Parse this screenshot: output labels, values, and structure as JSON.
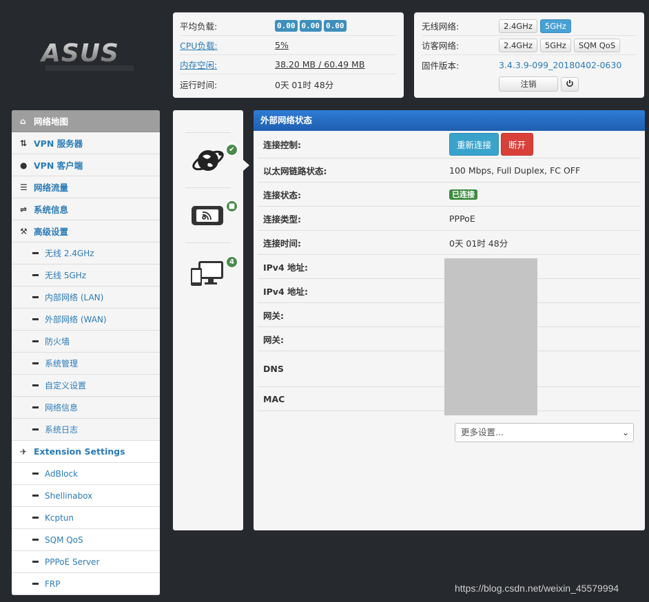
{
  "brand": {
    "logo_text": "ASUS"
  },
  "stats": {
    "avg_load_label": "平均负载:",
    "avg_load_values": [
      "0.00",
      "0.00",
      "0.00"
    ],
    "cpu_label": "CPU负载:",
    "cpu_value": "5%",
    "mem_label": "内存空闲:",
    "mem_value": "38.20 MB / 60.49 MB",
    "uptime_label": "运行时间:",
    "uptime_value": "0天 01时 48分"
  },
  "wifi": {
    "wireless_label": "无线网络:",
    "wireless_buttons": [
      "2.4GHz",
      "5GHz"
    ],
    "guest_label": "访客网络:",
    "guest_buttons": [
      "2.4GHz",
      "5GHz",
      "SQM QoS"
    ],
    "firmware_label": "固件版本:",
    "firmware_value": "3.4.3.9-099_20180402-0630",
    "logout_label": "注销",
    "power_icon": "power-icon"
  },
  "sidebar": {
    "items": [
      {
        "label": "网络地图",
        "icon": "home-icon"
      },
      {
        "label": "VPN 服务器",
        "icon": "retweet-icon"
      },
      {
        "label": "VPN 客户端",
        "icon": "globe-icon"
      },
      {
        "label": "网络流量",
        "icon": "list-icon"
      },
      {
        "label": "系统信息",
        "icon": "shuffle-icon"
      },
      {
        "label": "高级设置",
        "icon": "wrench-icon"
      }
    ],
    "advanced": [
      "无线 2.4GHz",
      "无线 5GHz",
      "内部网络 (LAN)",
      "外部网络 (WAN)",
      "防火墙",
      "系统管理",
      "自定义设置",
      "网络信息",
      "系统日志"
    ],
    "extension_label": "Extension Settings",
    "extension_icon": "plane-icon",
    "extensions": [
      "AdBlock",
      "Shellinabox",
      "Kcptun",
      "SQM QoS",
      "PPPoE Server",
      "FRP"
    ]
  },
  "devices": {
    "client_count": "4"
  },
  "wan": {
    "title": "外部网络状态",
    "rows": [
      {
        "label": "连接控制:",
        "value": ""
      },
      {
        "label": "以太网链路状态:",
        "value": "100 Mbps, Full Duplex, FC OFF"
      },
      {
        "label": "连接状态:",
        "value": ""
      },
      {
        "label": "连接类型:",
        "value": "PPPoE"
      },
      {
        "label": "连接时间:",
        "value": "0天 01时 48分"
      },
      {
        "label": "IPv4 地址:",
        "value": ""
      },
      {
        "label": "IPv4 地址:",
        "value": ""
      },
      {
        "label": "网关:",
        "value": ""
      },
      {
        "label": "网关:",
        "value": ""
      },
      {
        "label": "DNS",
        "value": ""
      },
      {
        "label": "MAC",
        "value": ""
      }
    ],
    "reconnect_label": "重新连接",
    "disconnect_label": "断开",
    "status_badge": "已连接",
    "more_select": "更多设置..."
  },
  "watermark": "https://blog.csdn.net/weixin_45579994"
}
